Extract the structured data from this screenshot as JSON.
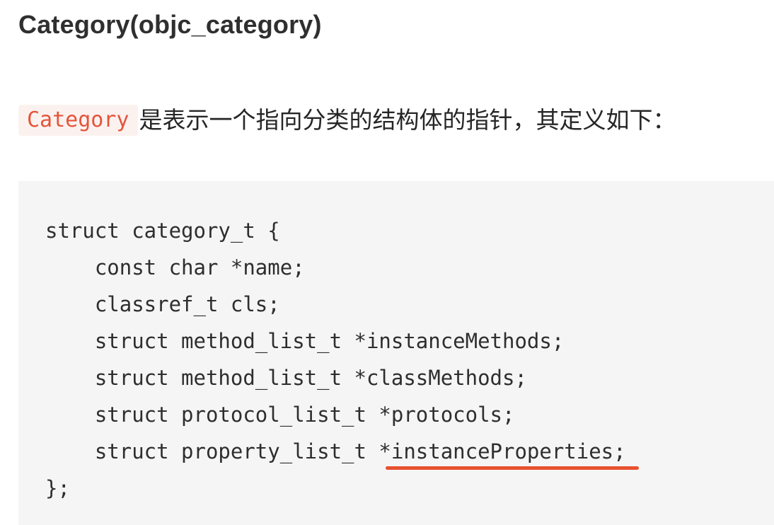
{
  "heading": "Category(objc_category)",
  "intro": {
    "code": "Category",
    "text": "是表示一个指向分类的结构体的指针，其定义如下："
  },
  "code_block": {
    "lines": [
      "struct category_t {",
      "    const char *name;",
      "    classref_t cls;",
      "    struct method_list_t *instanceMethods;",
      "    struct method_list_t *classMethods;",
      "    struct protocol_list_t *protocols;",
      "    struct property_list_t ",
      "};"
    ],
    "highlighted": "*instanceProperties;"
  },
  "colors": {
    "inline_code_text": "#e5543a",
    "inline_code_bg": "#fbf2f0",
    "code_bg": "#f5f5f5",
    "underline": "#e8512f"
  }
}
